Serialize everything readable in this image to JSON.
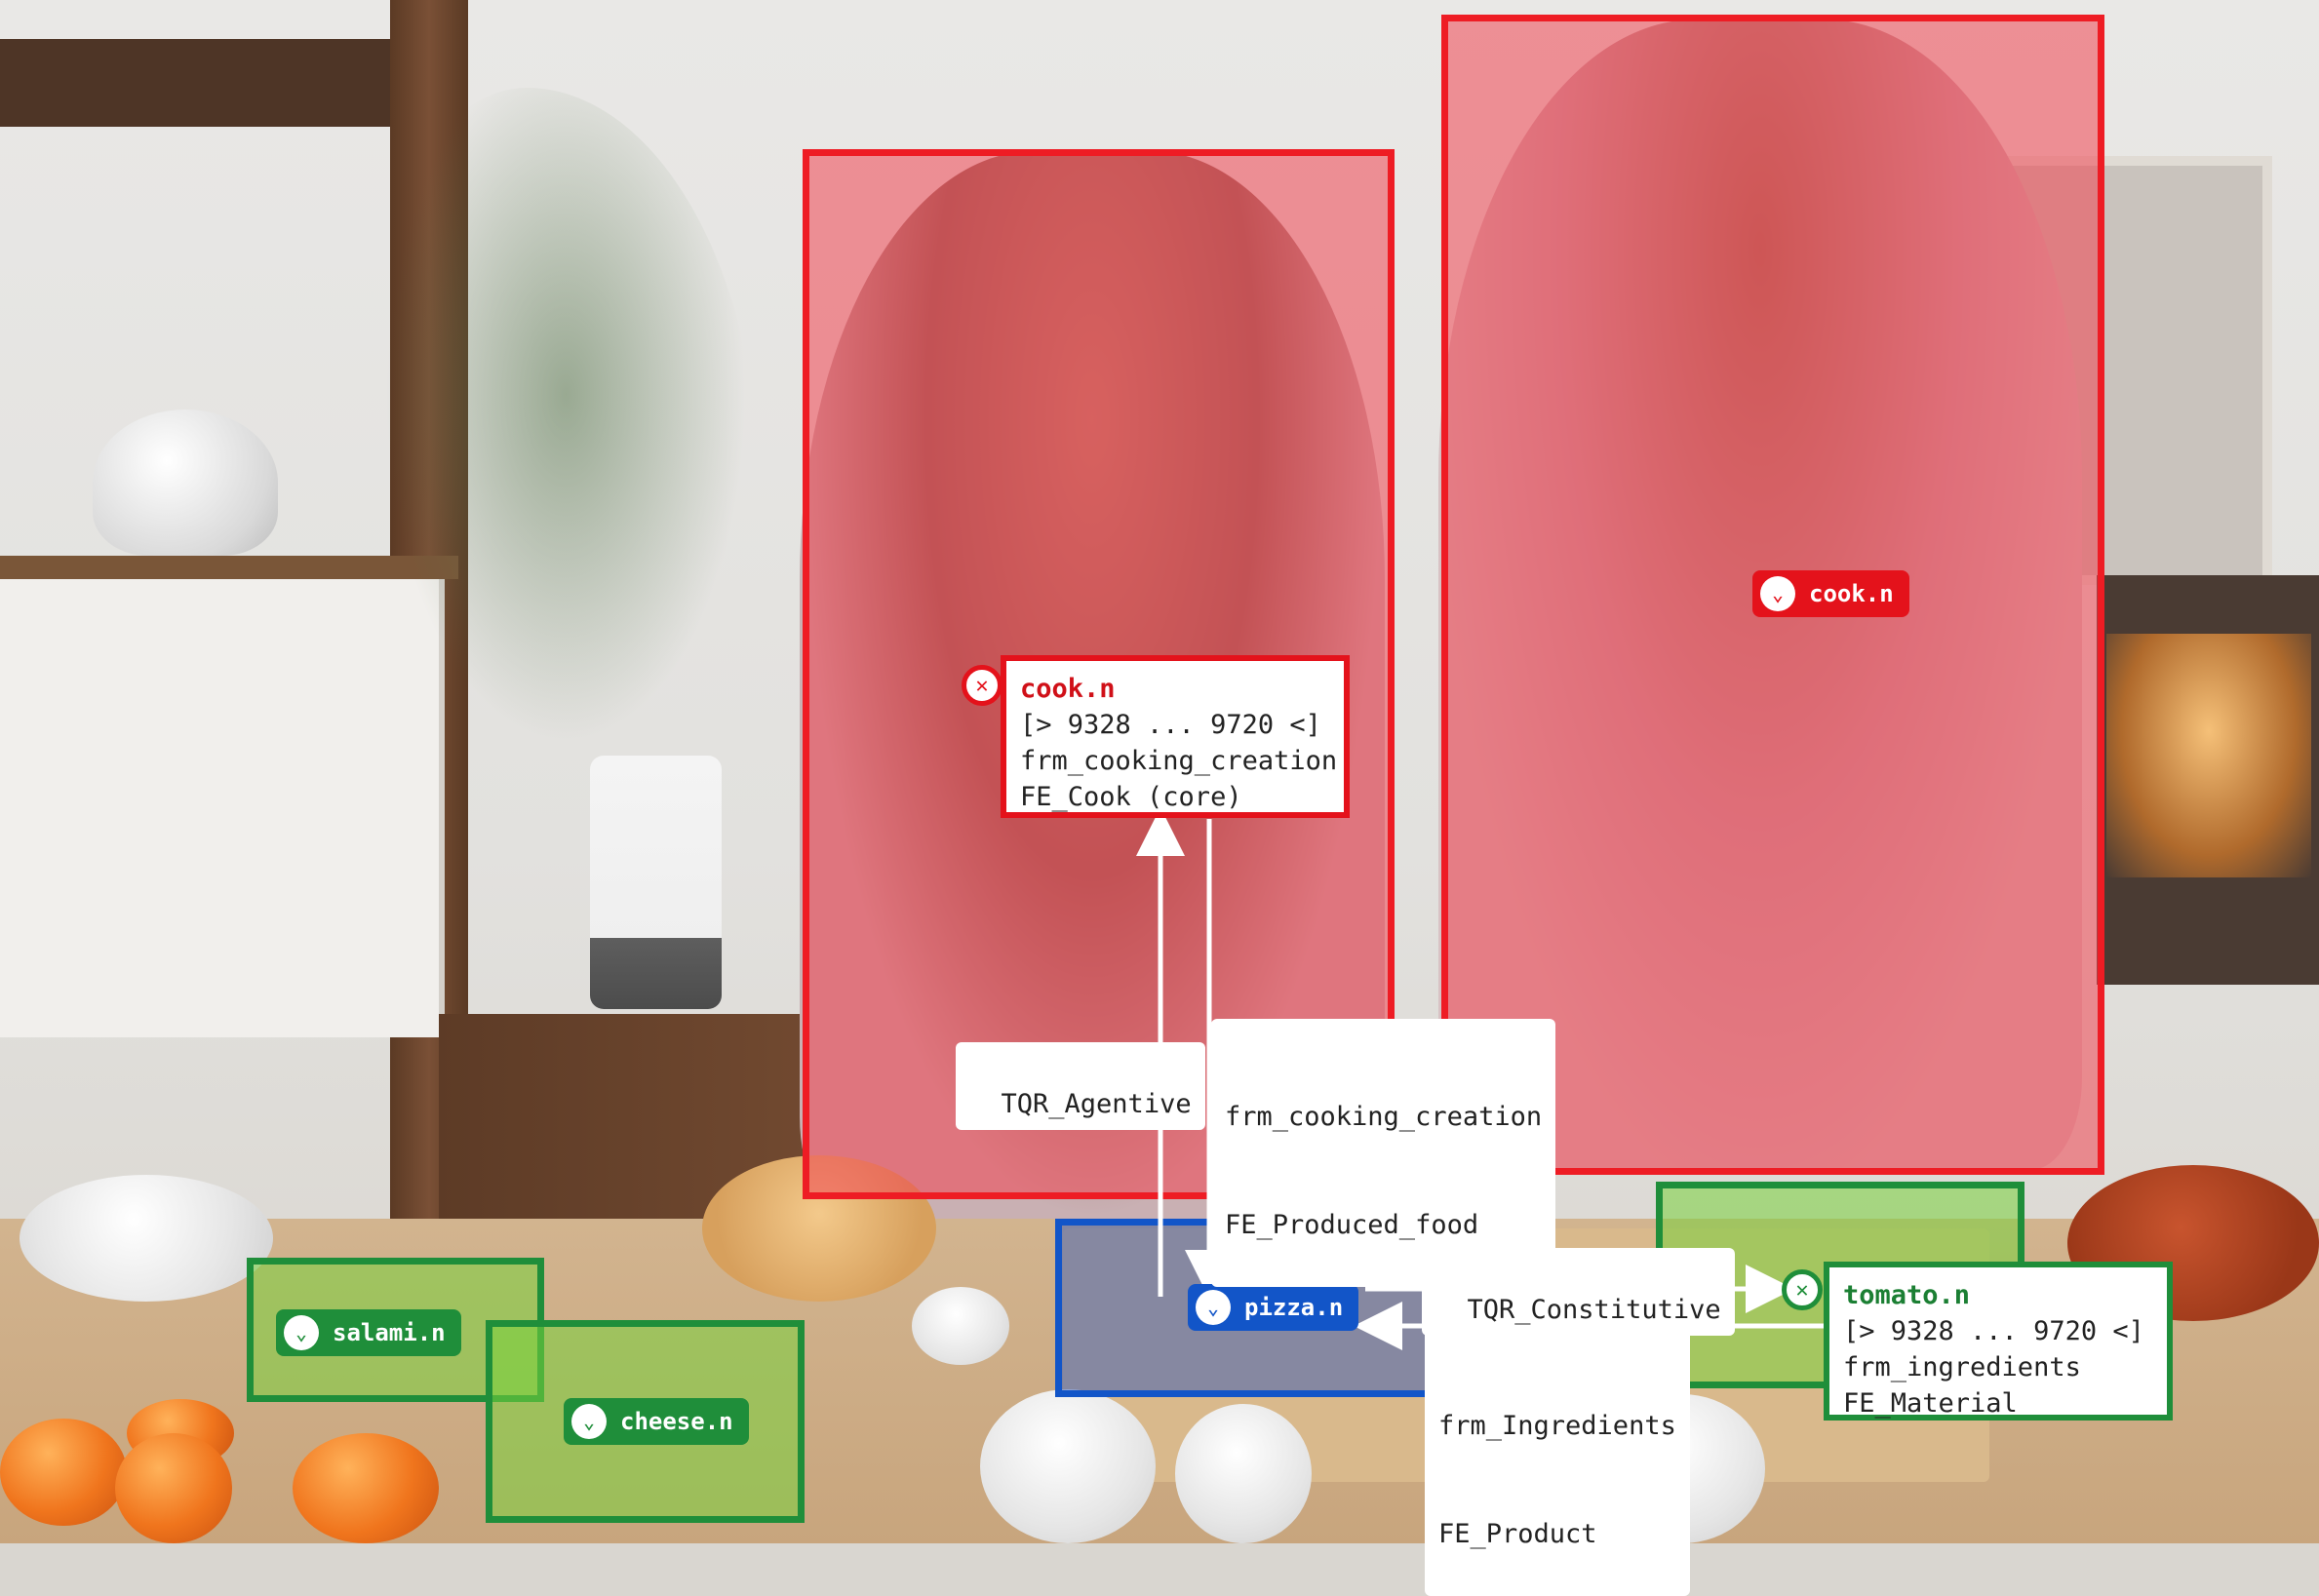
{
  "colors": {
    "agent_red": "#e4121b",
    "entity_blue": "#1255c8",
    "ingredient_green": "#1f8e3a"
  },
  "boxes": {
    "cook_left": {
      "label": "cook.n",
      "class": "agent"
    },
    "cook_right": {
      "label": "cook.n",
      "class": "agent"
    },
    "pizza": {
      "label": "pizza.n",
      "class": "entity"
    },
    "tomato": {
      "label": "tomato.n",
      "class": "ingredient"
    },
    "salami": {
      "label": "salami.n",
      "class": "ingredient"
    },
    "cheese": {
      "label": "cheese.n",
      "class": "ingredient"
    }
  },
  "cards": {
    "cook": {
      "title": "cook.n",
      "span": "[> 9328 ... 9720 <]",
      "frame": "frm_cooking_creation",
      "element": "FE_Cook (core)"
    },
    "tomato": {
      "title": "tomato.n",
      "span": "[> 9328 ... 9720 <]",
      "frame": "frm_ingredients",
      "element": "FE_Material"
    }
  },
  "edges": {
    "agentive": "TQR_Agentive",
    "produced_food_frame": "frm_cooking_creation",
    "produced_food_fe": "FE_Produced_food",
    "constitutive": "TQR_Constitutive",
    "ingredients_frame": "frm_Ingredients",
    "ingredients_fe": "FE_Product"
  },
  "icons": {
    "expand": "chevron-down-icon",
    "close": "close-icon"
  }
}
